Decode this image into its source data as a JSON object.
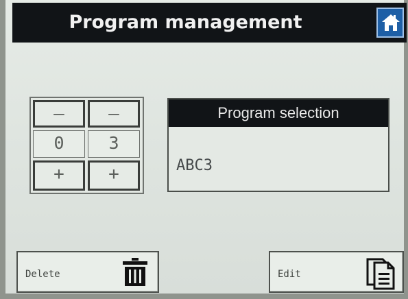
{
  "header": {
    "title": "Program management",
    "home_icon": "home-icon"
  },
  "stepper": {
    "minus_symbol": "—",
    "plus_symbol": "+",
    "digits": [
      "0",
      "3"
    ]
  },
  "program": {
    "header": "Program selection",
    "value": "ABC3"
  },
  "actions": {
    "delete_label": "Delete",
    "delete_icon": "trash-icon",
    "edit_label": "Edit",
    "edit_icon": "document-edit-icon"
  },
  "colors": {
    "titlebar": "#111417",
    "home_button": "#1e5fa6",
    "background": "#e4e9e4"
  }
}
